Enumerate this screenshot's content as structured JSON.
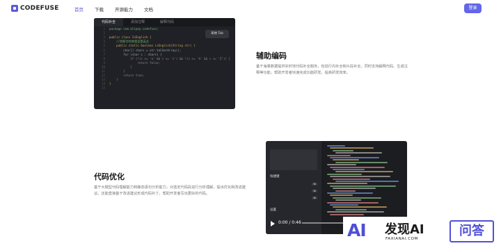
{
  "nav": {
    "logo": "CODEFUSE",
    "menu": [
      "首页",
      "下载",
      "开源能力",
      "文档"
    ],
    "active_index": 0,
    "login": "登录"
  },
  "code_panel": {
    "tabs": [
      "代码补全",
      "添加注释",
      "解释代码"
    ],
    "active_tab": 0,
    "lines": [
      {
        "n": "1",
        "text": "package com.alipay.codefuse;",
        "color": "#6fb36f"
      },
      {
        "n": "2",
        "text": "",
        "color": "#ccc"
      },
      {
        "n": "3",
        "text": "public class IsEnglish {",
        "color": "#d0a85c"
      },
      {
        "n": "4",
        "text": "    //判断字符串是否是英文",
        "color": "#6fb36f"
      },
      {
        "n": "5",
        "text": "    public static boolean isEnglish(String str) {",
        "color": "#c9a55b"
      },
      {
        "n": "6",
        "text": "        char[] chars = str.toCharArray();",
        "color": "#9aa"
      },
      {
        "n": "7",
        "text": "        for (char c : chars) {",
        "color": "#9aa"
      },
      {
        "n": "8",
        "text": "            if (!(c >= 'a' && c <= 'z') && !(c >= 'A' && c <= 'Z')) {",
        "color": "#8a8a8a"
      },
      {
        "n": "9",
        "text": "                return false;",
        "color": "#8a8a8a"
      },
      {
        "n": "10",
        "text": "            }",
        "color": "#8a8a8a"
      },
      {
        "n": "11",
        "text": "        }",
        "color": "#8a8a8a"
      },
      {
        "n": "12",
        "text": "        return true;",
        "color": "#8a8a8a"
      },
      {
        "n": "13",
        "text": "    }",
        "color": "#8a8a8a"
      },
      {
        "n": "14",
        "text": "}",
        "color": "#d0a85c"
      },
      {
        "n": "15",
        "text": "",
        "color": "#ccc"
      }
    ],
    "tip": "采纳  Tab"
  },
  "section_assist": {
    "title": "辅助编码",
    "desc": "基于海量数据提供实时地代码补全服务，包括行内补全和片段补全。同时支持解释代码、生成注释等功能，帮助开发者快速完成功能研发，提高研发效率。"
  },
  "section_optimize": {
    "title": "代码优化",
    "desc": "基于大模型代码理解能力和静态语句分析能力，对选定代码段进行分析理解，提出优化和改进建议。还能直接基于改进建议形成代码补丁，帮助开发者写出更好的代码。"
  },
  "video": {
    "side_title": "快捷键",
    "side_section": "设置",
    "time": "0:00 / 0:46"
  },
  "watermark": {
    "ai": "AI",
    "cn": "发现AI",
    "en": "FAXIANAI.COM",
    "badge": "问答"
  }
}
